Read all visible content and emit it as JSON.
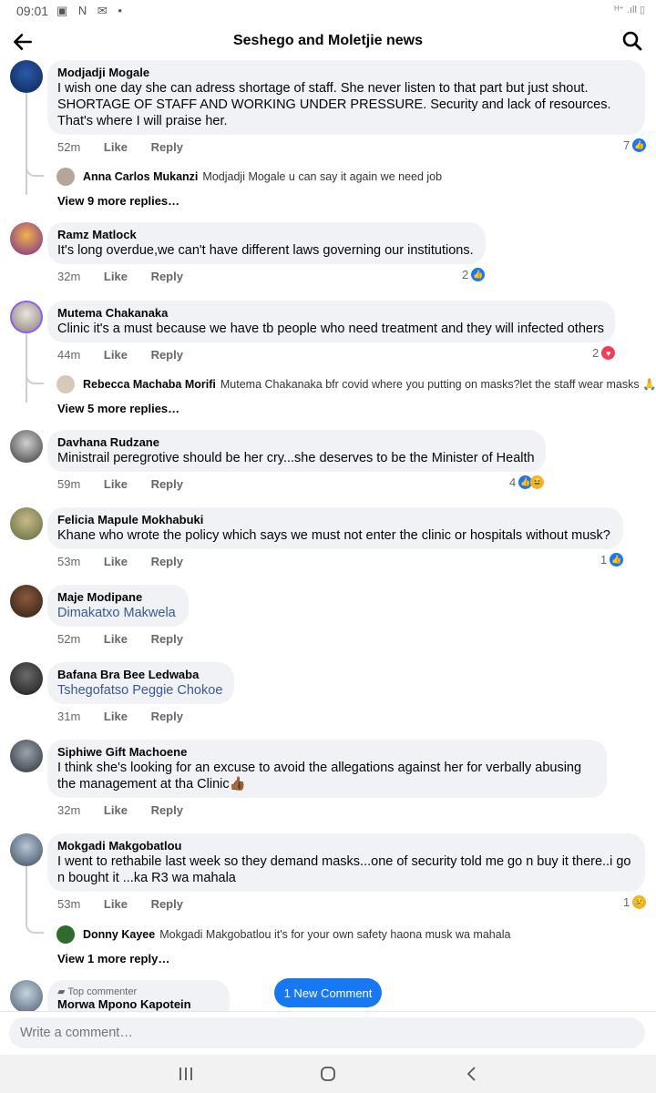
{
  "status_bar": {
    "time": "09:01",
    "left_icons": "▣ N ✉ •",
    "right_icons": "ᴴ⁺ .ıll ▯"
  },
  "header": {
    "title": "Seshego and Moletjie news"
  },
  "actions": {
    "like": "Like",
    "reply": "Reply"
  },
  "comments": [
    {
      "author": "Modjadji Mogale",
      "text": "I wish one day she can adress shortage of staff. She never listen to that part but just shout. SHORTAGE OF STAFF AND WORKING UNDER PRESSURE. Security and lack of resources. That's where I will praise her.",
      "time": "52m",
      "reactions": "7",
      "reply": {
        "author": "Anna Carlos Mukanzi",
        "text": "Modjadji Mogale u can say it again we need job"
      },
      "view_more": "View 9 more replies…"
    },
    {
      "author": "Ramz Matlock",
      "text": "It's long overdue,we can't have different laws governing our institutions.",
      "time": "32m",
      "reactions": "2"
    },
    {
      "author": "Mutema Chakanaka",
      "text": "Clinic it's a must because we have tb people who need treatment and they will infected others",
      "time": "44m",
      "reactions": "2",
      "reply": {
        "author": "Rebecca Machaba Morifi",
        "text": "Mutema Chakanaka bfr covid where you putting on masks?let the staff wear masks 🙏"
      },
      "view_more": "View 5 more replies…"
    },
    {
      "author": "Davhana Rudzane",
      "text": "Ministrail peregrotive should be her cry...she deserves to be the Minister of Health",
      "time": "59m",
      "reactions": "4"
    },
    {
      "author": "Felicia Mapule Mokhabuki",
      "text": "Khane who wrote the policy which says we must not enter the clinic or hospitals without musk?",
      "time": "53m",
      "reactions": "1"
    },
    {
      "author": "Maje Modipane",
      "text": "Dimakatxo Makwela",
      "time": "52m"
    },
    {
      "author": "Bafana Bra Bee Ledwaba",
      "text": "Tshegofatso Peggie Chokoe",
      "time": "31m"
    },
    {
      "author": "Siphiwe Gift Machoene",
      "text": "I think she's looking for an excuse to avoid the allegations against her for verbally abusing the management at tha Clinic👍🏾",
      "time": "32m"
    },
    {
      "author": "Mokgadi Makgobatlou",
      "text": "I went to rethabile last week so they demand masks...one of security told me go n buy it there..i go n bought it ...ka R3 wa mahala",
      "time": "53m",
      "reactions": "1",
      "reply": {
        "author": "Donny Kayee",
        "text": "Mokgadi Makgobatlou it's for your own safety haona musk wa mahala"
      },
      "view_more": "View 1 more reply…"
    },
    {
      "tag": "Top commenter",
      "author": "Morwa Mpono Kapotein Malepe"
    }
  ],
  "new_comment_label": "1 New Comment",
  "composer": {
    "placeholder": "Write a comment…"
  },
  "colors": {
    "accent": "#1877f2",
    "bubble": "#f0f2f5",
    "love": "#f33e58"
  }
}
